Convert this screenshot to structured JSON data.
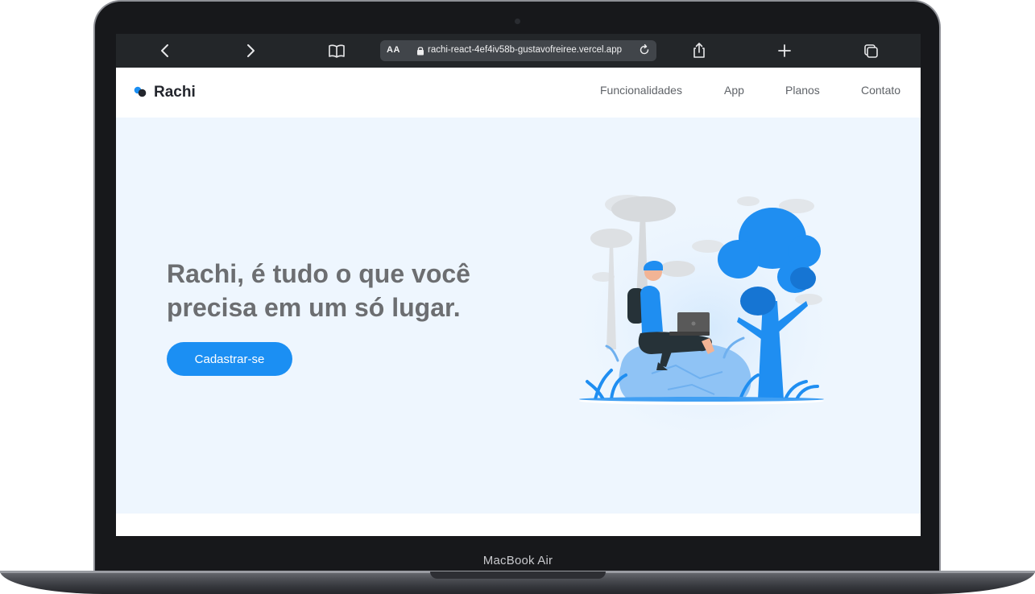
{
  "device": {
    "chin_label": "MacBook Air"
  },
  "browser": {
    "text_size_label": "AA",
    "url": "rachi-react-4ef4iv58b-gustavofreiree.vercel.app",
    "icons": {
      "back": "chevron-left-icon",
      "forward": "chevron-right-icon",
      "bookmarks": "book-icon",
      "lock": "lock-icon",
      "reload": "reload-icon",
      "share": "share-icon",
      "new_tab": "plus-icon",
      "tabs": "tabs-icon"
    }
  },
  "site": {
    "brand": "Rachi",
    "nav": [
      "Funcionalidades",
      "App",
      "Planos",
      "Contato"
    ],
    "hero": {
      "title": "Rachi, é tudo o que você precisa em um só lugar.",
      "cta_label": "Cadastrar-se"
    },
    "colors": {
      "primary": "#1b8ff3",
      "hero_background": "#eef6fe",
      "title_text": "#6c6e71",
      "brand_text": "#23262d"
    }
  }
}
